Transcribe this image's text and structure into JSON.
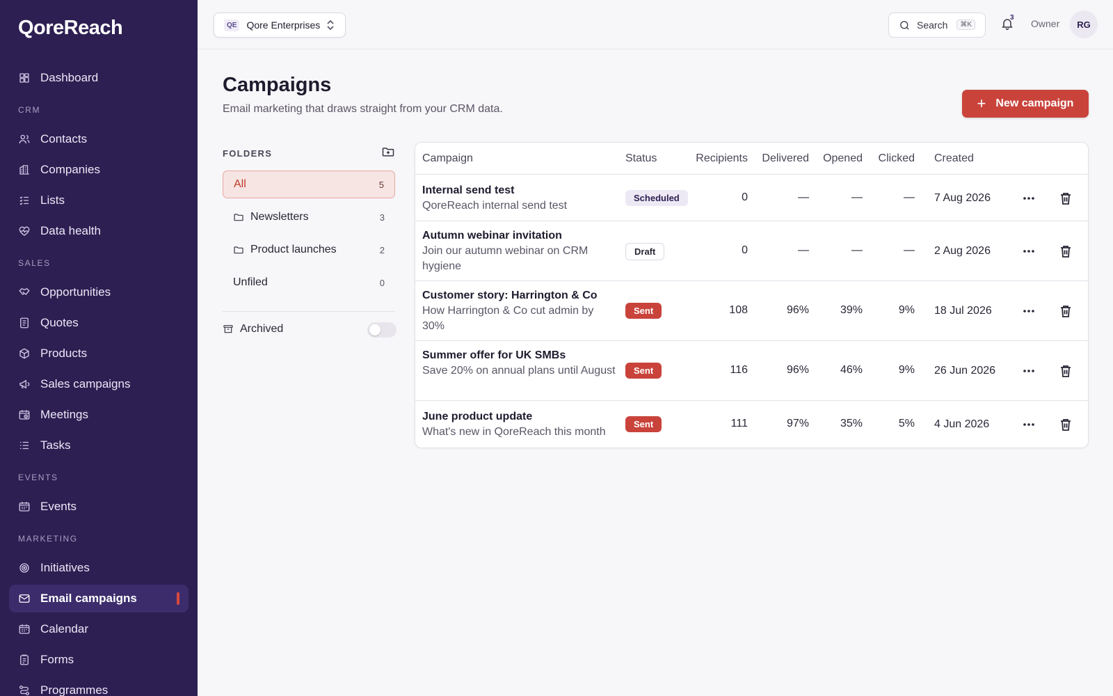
{
  "app": {
    "brand": "QoreReach"
  },
  "sidebar": {
    "top": [
      {
        "label": "Dashboard",
        "icon": "dashboard-icon"
      }
    ],
    "sections": [
      {
        "title": "CRM",
        "items": [
          {
            "label": "Contacts",
            "icon": "contacts-icon"
          },
          {
            "label": "Companies",
            "icon": "companies-icon"
          },
          {
            "label": "Lists",
            "icon": "lists-icon"
          },
          {
            "label": "Data health",
            "icon": "heart-pulse-icon"
          }
        ]
      },
      {
        "title": "SALES",
        "items": [
          {
            "label": "Opportunities",
            "icon": "handshake-icon"
          },
          {
            "label": "Quotes",
            "icon": "quote-doc-icon"
          },
          {
            "label": "Products",
            "icon": "package-icon"
          },
          {
            "label": "Sales campaigns",
            "icon": "megaphone-icon"
          },
          {
            "label": "Meetings",
            "icon": "calendar-clock-icon"
          },
          {
            "label": "Tasks",
            "icon": "tasks-icon"
          }
        ]
      },
      {
        "title": "EVENTS",
        "items": [
          {
            "label": "Events",
            "icon": "calendar-icon"
          }
        ]
      },
      {
        "title": "MARKETING",
        "items": [
          {
            "label": "Initiatives",
            "icon": "target-icon"
          },
          {
            "label": "Email campaigns",
            "icon": "mail-icon",
            "active": true
          },
          {
            "label": "Calendar",
            "icon": "calendar-icon"
          },
          {
            "label": "Forms",
            "icon": "clipboard-icon"
          },
          {
            "label": "Programmes",
            "icon": "workflow-icon"
          }
        ]
      }
    ]
  },
  "topbar": {
    "org_badge": "QE",
    "org_name": "Qore Enterprises",
    "search_label": "Search",
    "search_shortcut": "⌘K",
    "notification_count": "3",
    "role": "Owner",
    "avatar_initials": "RG"
  },
  "page": {
    "title": "Campaigns",
    "subtitle": "Email marketing that draws straight from your CRM data.",
    "new_button": "New campaign"
  },
  "folders": {
    "title": "FOLDERS",
    "items": [
      {
        "label": "All",
        "count": "5",
        "active": true,
        "icon": ""
      },
      {
        "label": "Newsletters",
        "count": "3",
        "icon": "folder-icon"
      },
      {
        "label": "Product launches",
        "count": "2",
        "icon": "folder-icon"
      },
      {
        "label": "Unfiled",
        "count": "0",
        "icon": ""
      }
    ],
    "archived_label": "Archived",
    "archived_on": false
  },
  "table": {
    "headers": [
      "Campaign",
      "Status",
      "Recipients",
      "Delivered",
      "Opened",
      "Clicked",
      "Created"
    ],
    "rows": [
      {
        "name": "Internal send test",
        "desc": "QoreReach internal send test",
        "status": "Scheduled",
        "recipients": "0",
        "delivered": "—",
        "opened": "—",
        "clicked": "—",
        "created": "7 Aug 2026"
      },
      {
        "name": "Autumn webinar invitation",
        "desc": "Join our autumn webinar on CRM hygiene",
        "status": "Draft",
        "recipients": "0",
        "delivered": "—",
        "opened": "—",
        "clicked": "—",
        "created": "2 Aug 2026"
      },
      {
        "name": "Customer story: Harrington & Co",
        "desc": "How Harrington & Co cut admin by 30%",
        "status": "Sent",
        "recipients": "108",
        "delivered": "96%",
        "opened": "39%",
        "clicked": "9%",
        "created": "18 Jul 2026"
      },
      {
        "name": "Summer offer for UK SMBs",
        "desc": "Save 20% on annual plans until August",
        "status": "Sent",
        "recipients": "116",
        "delivered": "96%",
        "opened": "46%",
        "clicked": "9%",
        "created": "26 Jun 2026"
      },
      {
        "name": "June product update",
        "desc": "What's new in QoreReach this month",
        "status": "Sent",
        "recipients": "111",
        "delivered": "97%",
        "opened": "35%",
        "clicked": "5%",
        "created": "4 Jun 2026"
      }
    ]
  },
  "colors": {
    "sidebar_bg": "#2d1f52",
    "accent": "#c9433b",
    "active_nav": "#3c2c6c"
  }
}
